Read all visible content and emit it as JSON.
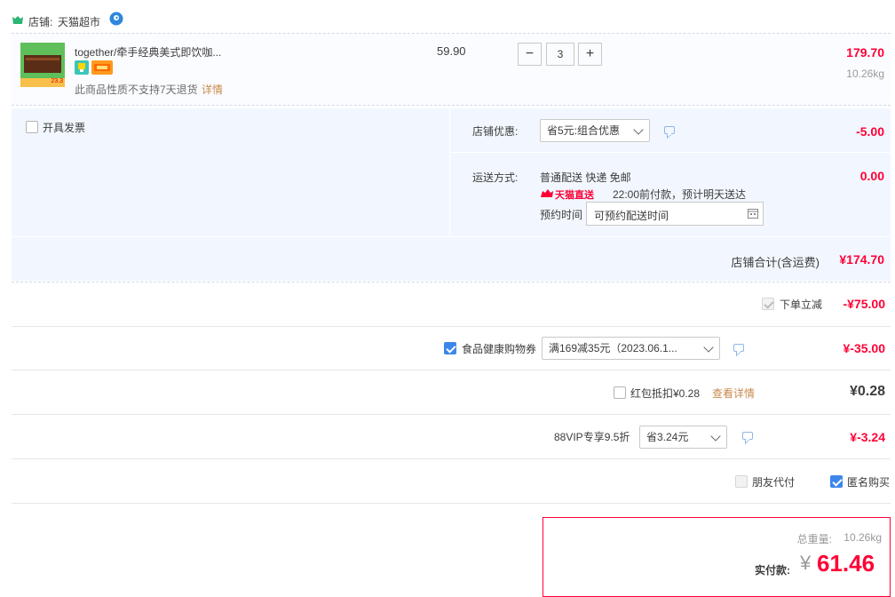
{
  "shop": {
    "label": "店铺:",
    "name": "天猫超市"
  },
  "item": {
    "title": "together/牵手经典美式即饮咖...",
    "unit_price": "59.90",
    "quantity": "3",
    "minus": "−",
    "plus": "+",
    "subtotal": "179.70",
    "weight": "10.26kg",
    "notice": "此商品性质不支持7天退货",
    "detail_link": "详情",
    "thumb_badge": "23.3"
  },
  "invoice": {
    "label": "开具发票"
  },
  "store_discount": {
    "label": "店铺优惠:",
    "selected": "省5元:组合优惠",
    "amount": "-5.00"
  },
  "shipping": {
    "label": "运送方式:",
    "method": "普通配送 快递 免邮",
    "tmall_direct": "天猫直送",
    "eta": "22:00前付款，预计明天送达",
    "appointment_label": "预约时间",
    "appointment_placeholder": "可预约配送时间",
    "fee": "0.00"
  },
  "store_total": {
    "label": "店铺合计(含运费)",
    "amount": "¥174.70"
  },
  "order_discount": {
    "label": "下单立减",
    "amount": "-¥75.00"
  },
  "coupon": {
    "label": "食品健康购物券",
    "selected": "满169减35元（2023.06.1...",
    "amount": "¥-35.00"
  },
  "red_packet": {
    "label": "红包抵扣¥0.28",
    "link": "查看详情",
    "amount": "¥0.28"
  },
  "vip": {
    "label": "88VIP专享9.5折",
    "selected": "省3.24元",
    "amount": "¥-3.24"
  },
  "options": {
    "friend_pay": "朋友代付",
    "anonymous": "匿名购买"
  },
  "summary": {
    "weight_label": "总重量:",
    "weight_value": "10.26kg",
    "pay_label": "实付款:",
    "currency": "¥",
    "pay_amount": "61.46"
  },
  "colors": {
    "accent_red": "#ff0036",
    "checkbox_blue": "#3d86ea",
    "panel_bg": "#f2f7ff"
  }
}
